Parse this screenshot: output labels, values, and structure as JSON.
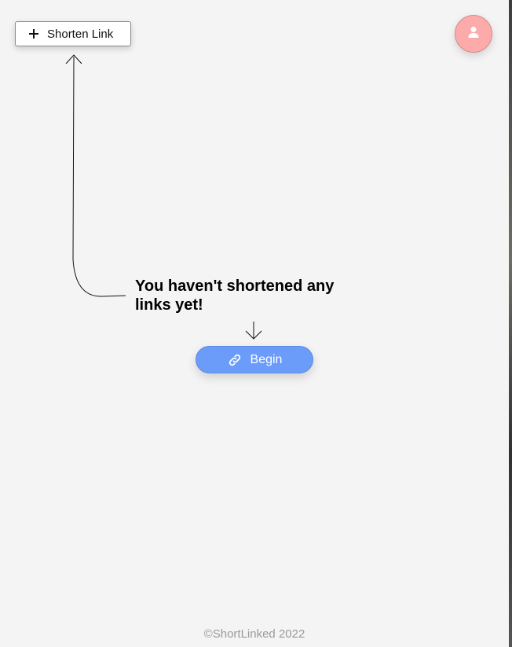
{
  "header": {
    "shorten_button_label": "Shorten Link",
    "shorten_button_icon": "plus-icon",
    "avatar_icon": "user-icon"
  },
  "empty_state": {
    "message": "You haven't shortened any links yet!",
    "begin_button_label": "Begin",
    "begin_button_icon": "link-icon"
  },
  "footer": {
    "copyright": "©ShortLinked 2022"
  },
  "colors": {
    "background": "#f4f4f4",
    "avatar": "#fdaaaa",
    "primary_button": "#6b9cfa",
    "footer_text": "#9a9a9a"
  }
}
